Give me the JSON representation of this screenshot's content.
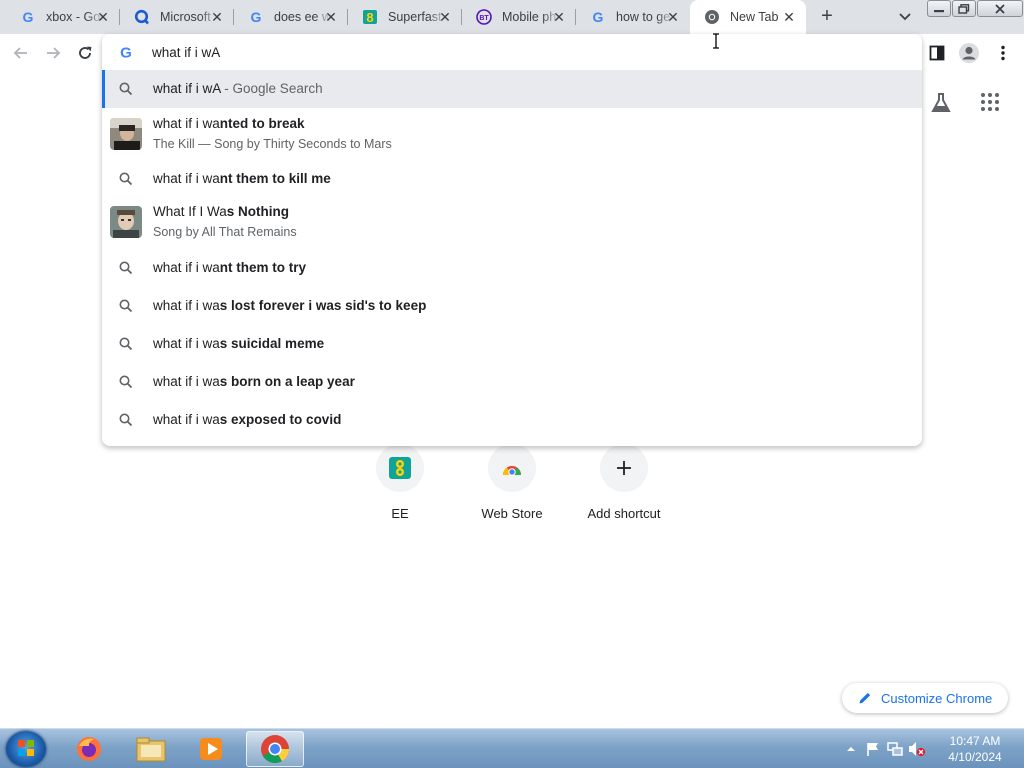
{
  "browser": {
    "tabs": [
      {
        "title": "xbox - Goog",
        "favicon": "google-icon"
      },
      {
        "title": "Microsoft",
        "favicon": "bing-q-icon"
      },
      {
        "title": "does ee wi",
        "favicon": "google-icon"
      },
      {
        "title": "Superfast",
        "favicon": "ee-icon"
      },
      {
        "title": "Mobile ph",
        "favicon": "bt-icon"
      },
      {
        "title": "how to ge",
        "favicon": "google-icon"
      },
      {
        "title": "New Tab",
        "favicon": "chrome-icon",
        "active": true
      }
    ]
  },
  "omnibox": {
    "value": "what if i wA",
    "suggestions": [
      {
        "prefix": "what if i wA",
        "suffix": " - Google Search",
        "type": "search",
        "highlighted": true
      },
      {
        "prefix": "what if i wa",
        "bold": "nted to break",
        "subtitle": "The Kill — Song by Thirty Seconds to Mars",
        "type": "entity",
        "thumb": "thirty-seconds-to-mars-thumbnail"
      },
      {
        "prefix": "what if i wa",
        "bold": "nt them to kill me",
        "type": "search"
      },
      {
        "prefix": "What If I Wa",
        "bold": "s Nothing",
        "subtitle": "Song by All That Remains",
        "type": "entity",
        "thumb": "all-that-remains-thumbnail"
      },
      {
        "prefix": "what if i wa",
        "bold": "nt them to try",
        "type": "search"
      },
      {
        "prefix": "what if i wa",
        "bold": "s lost forever i was sid's to keep",
        "type": "search"
      },
      {
        "prefix": "what if i wa",
        "bold": "s suicidal meme",
        "type": "search"
      },
      {
        "prefix": "what if i wa",
        "bold": "s born on a leap year",
        "type": "search"
      },
      {
        "prefix": "what if i wa",
        "bold": "s exposed to covid",
        "type": "search"
      }
    ]
  },
  "newtab": {
    "shortcuts": [
      {
        "label": "EE",
        "icon": "ee-icon"
      },
      {
        "label": "Web Store",
        "icon": "web-store-icon"
      },
      {
        "label": "Add shortcut",
        "icon": "plus-icon"
      }
    ],
    "customize_label": "Customize Chrome"
  },
  "taskbar": {
    "apps": [
      "internet-explorer-icon",
      "firefox-icon",
      "file-explorer-icon",
      "media-player-icon",
      "chrome-icon"
    ],
    "time": "10:47 AM",
    "date": "4/10/2024"
  },
  "colors": {
    "accent": "#1a73e8",
    "tabstrip": "#dee1e6",
    "highlight": "#e8eaed"
  }
}
